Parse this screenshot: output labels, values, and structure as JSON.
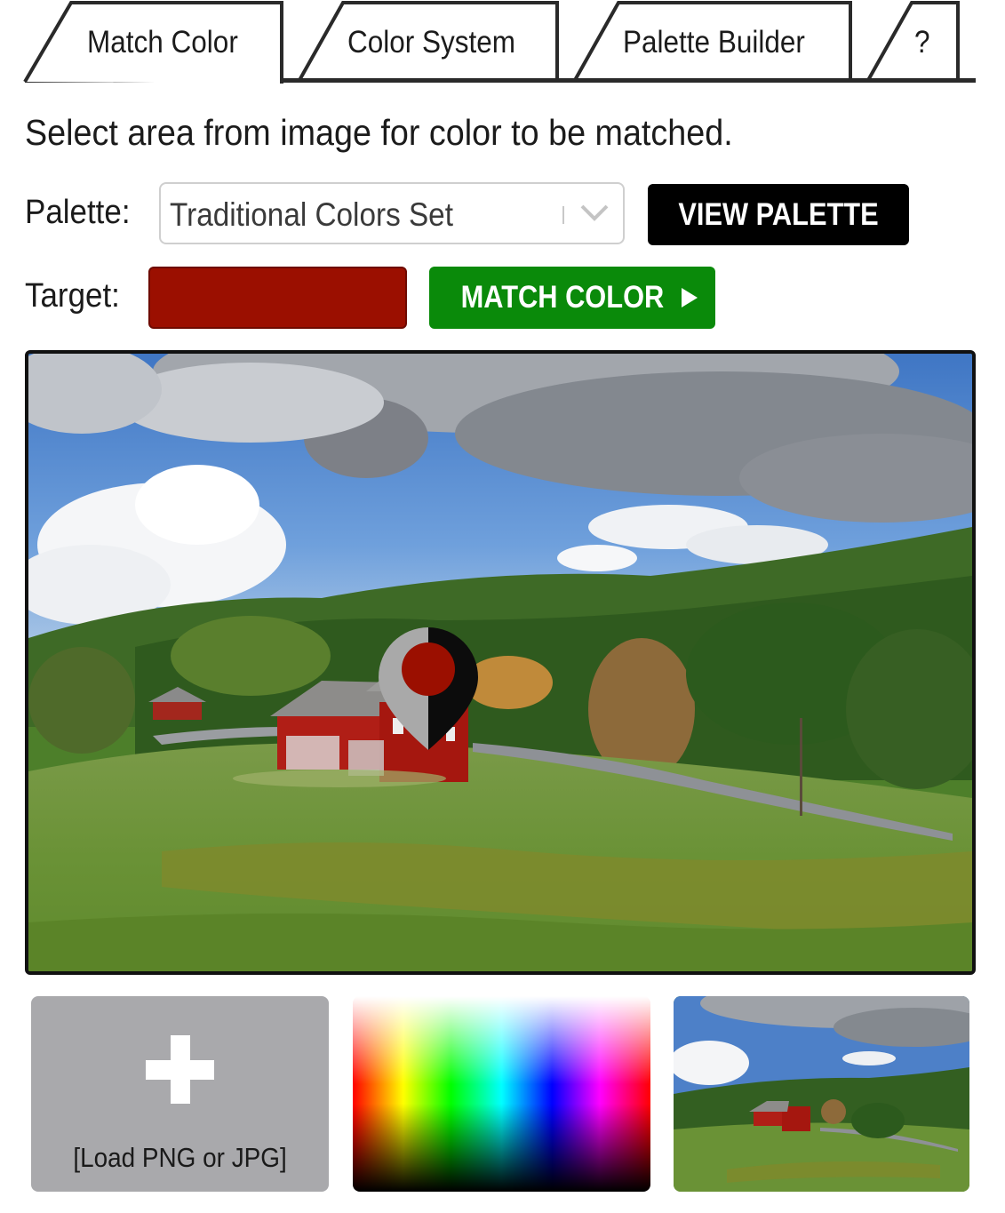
{
  "tabs": [
    {
      "label": "Match Color",
      "active": true
    },
    {
      "label": "Color System",
      "active": false
    },
    {
      "label": "Palette Builder",
      "active": false
    },
    {
      "label": "?",
      "active": false
    }
  ],
  "instruction": "Select area from image for color to be matched.",
  "palette": {
    "label": "Palette:",
    "selected": "Traditional Colors Set",
    "view_button": "VIEW PALETTE"
  },
  "target": {
    "label": "Target:",
    "color": "#9b0f00",
    "match_button": "MATCH COLOR"
  },
  "image": {
    "marker_color": "#9b0f00"
  },
  "tiles": {
    "load_label": "[Load PNG or JPG]"
  },
  "icons": {
    "select": "chevron-down-icon",
    "match": "play-arrow-icon",
    "marker": "map-pin-icon",
    "load": "plus-icon"
  }
}
